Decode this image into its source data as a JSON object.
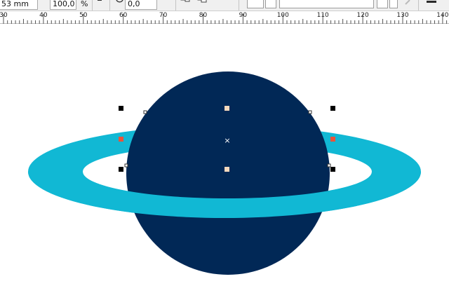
{
  "property_bar": {
    "object_size": "53 mm",
    "scale_value": "100,0",
    "scale_unit": "%",
    "rotation_value": "0,0",
    "icons": [
      "rotate-icon",
      "group-icon",
      "ungroup-icon",
      "eyedropper-icon",
      "align-icon"
    ]
  },
  "ruler": {
    "unit_marks": [
      "30",
      "40",
      "50",
      "60",
      "70",
      "80",
      "90",
      "100",
      "110",
      "120",
      "130",
      "140"
    ]
  },
  "drawing": {
    "planet_color": "#012856",
    "ring_color": "#11b8d4",
    "ring_inner_color": "#ffffff",
    "selection_handle_color": "#000000",
    "node_handle_color": "#f5d9bd",
    "rotation_handle_color": "#e8543a",
    "center_marker": "×"
  }
}
